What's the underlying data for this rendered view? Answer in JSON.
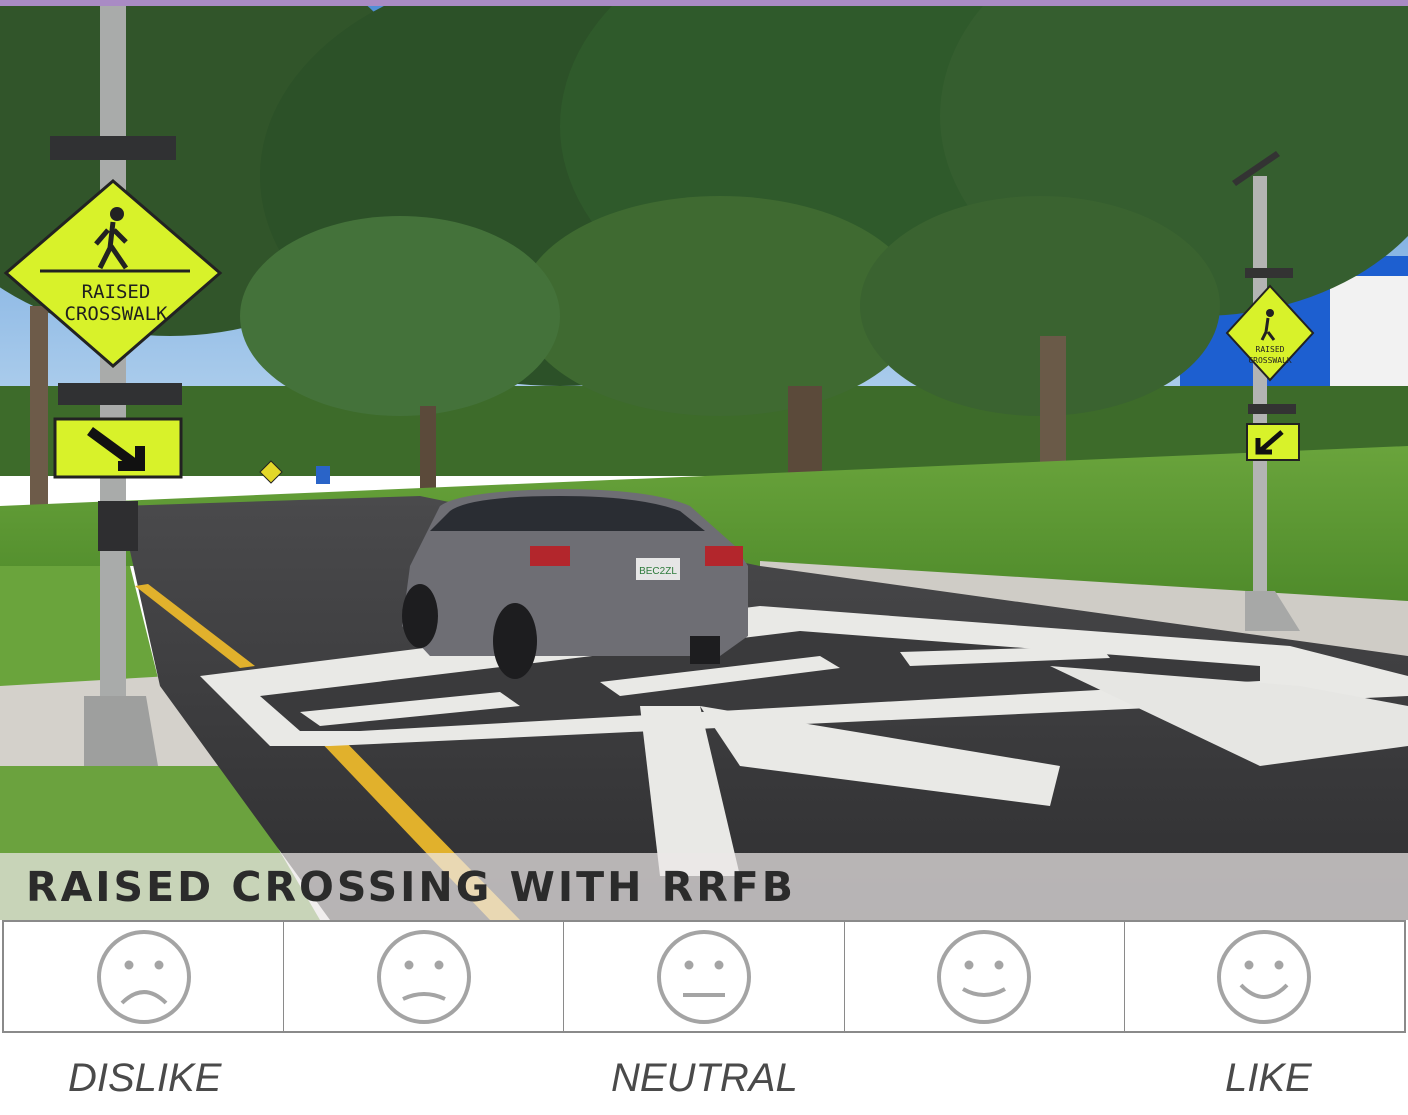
{
  "colors": {
    "accent_bar": "#a98bc4",
    "face_stroke": "#a4a4a4",
    "caption_text": "#2b2b2b",
    "label_text": "#4a4a4a"
  },
  "caption": "RAISED CROSSING WITH RRFB",
  "signs": {
    "left_sign_line1": "RAISED",
    "left_sign_line2": "CROSSWALK",
    "right_sign_line1": "RAISED",
    "right_sign_line2": "CROSSWALK",
    "license_plate": "BEC2ZL"
  },
  "rating_options": [
    {
      "name": "very-sad-face-icon",
      "mood": "very-dislike"
    },
    {
      "name": "sad-face-icon",
      "mood": "dislike"
    },
    {
      "name": "neutral-face-icon",
      "mood": "neutral"
    },
    {
      "name": "smile-face-icon",
      "mood": "like"
    },
    {
      "name": "big-smile-face-icon",
      "mood": "very-like"
    }
  ],
  "scale_labels": {
    "left": "DISLIKE",
    "middle": "NEUTRAL",
    "right": "LIKE"
  }
}
